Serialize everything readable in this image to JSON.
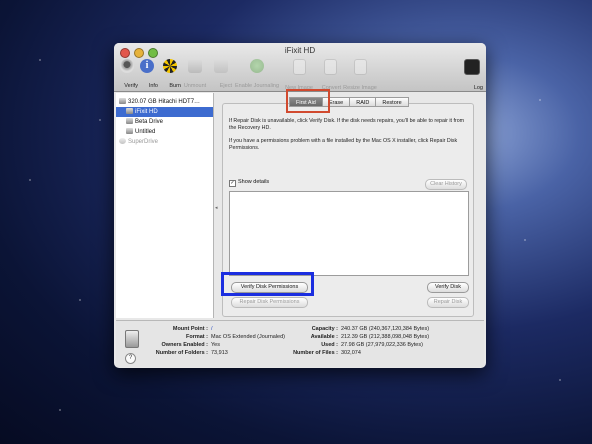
{
  "window": {
    "title": "iFixit HD"
  },
  "toolbar": [
    {
      "label": "Verify",
      "icon": "microscope-icon",
      "enabled": true
    },
    {
      "label": "Info",
      "icon": "info-icon",
      "enabled": true
    },
    {
      "label": "Burn",
      "icon": "burn-icon",
      "enabled": true
    },
    {
      "label": "Unmount",
      "icon": "unmount-icon",
      "enabled": false
    },
    {
      "label": "Eject",
      "icon": "eject-icon",
      "enabled": false
    },
    {
      "label": "Enable Journaling",
      "icon": "journaling-icon",
      "enabled": false
    },
    {
      "label": "New Image",
      "icon": "new-image-icon",
      "enabled": false
    },
    {
      "label": "Convert",
      "icon": "convert-icon",
      "enabled": false
    },
    {
      "label": "Resize Image",
      "icon": "resize-image-icon",
      "enabled": false
    },
    {
      "label": "Log",
      "icon": "log-icon",
      "enabled": true
    }
  ],
  "sidebar": {
    "items": [
      {
        "label": "320.07 GB Hitachi HDT7…",
        "level": 0,
        "selected": false
      },
      {
        "label": "iFixit HD",
        "level": 1,
        "selected": true
      },
      {
        "label": "Beta Drive",
        "level": 1,
        "selected": false
      },
      {
        "label": "Untitled",
        "level": 1,
        "selected": false
      },
      {
        "label": "SuperDrive",
        "level": 0,
        "selected": false,
        "dim": true
      }
    ]
  },
  "tabs": [
    {
      "label": "First Aid",
      "selected": true
    },
    {
      "label": "Erase",
      "selected": false
    },
    {
      "label": "RAID",
      "selected": false
    },
    {
      "label": "Restore",
      "selected": false
    }
  ],
  "first_aid": {
    "para1": "If Repair Disk is unavailable, click Verify Disk. If the disk needs repairs, you'll be able to repair it from the Recovery HD.",
    "para2": "If you have a permissions problem with a file installed by the Mac OS X installer, click Repair Disk Permissions.",
    "show_details_label": "Show details",
    "show_details_checked": true,
    "clear_history_label": "Clear History",
    "verify_permissions_label": "Verify Disk Permissions",
    "repair_permissions_label": "Repair Disk Permissions",
    "verify_disk_label": "Verify Disk",
    "repair_disk_label": "Repair Disk"
  },
  "info": {
    "left": [
      {
        "key": "Mount Point :",
        "value": "/"
      },
      {
        "key": "Format :",
        "value": "Mac OS Extended (Journaled)"
      },
      {
        "key": "Owners Enabled :",
        "value": "Yes"
      },
      {
        "key": "Number of Folders :",
        "value": "73,913"
      }
    ],
    "right": [
      {
        "key": "Capacity :",
        "value": "240.37 GB (240,367,120,384 Bytes)"
      },
      {
        "key": "Available :",
        "value": "212.39 GB (212,388,098,048 Bytes)"
      },
      {
        "key": "Used :",
        "value": "27.98 GB (27,979,022,336 Bytes)"
      },
      {
        "key": "Number of Files :",
        "value": "302,074"
      }
    ],
    "help_label": "?"
  },
  "colors": {
    "selection": "#3d6bd0",
    "highlight_red": "#d14a2f",
    "highlight_blue": "#1b2ee0"
  }
}
